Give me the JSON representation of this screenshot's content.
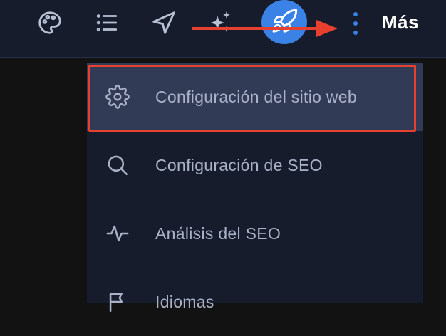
{
  "toolbar": {
    "icons": [
      "palette-icon",
      "list-icon",
      "navigation-icon",
      "sparkles-icon",
      "rocket-icon",
      "more-vertical-icon"
    ],
    "more_label": "Más",
    "accent_color": "#3b82e6"
  },
  "menu": {
    "items": [
      {
        "label": "Configuración del sitio web",
        "icon": "gear-icon",
        "active": true
      },
      {
        "label": "Configuración de SEO",
        "icon": "search-icon",
        "active": false
      },
      {
        "label": "Análisis del SEO",
        "icon": "activity-icon",
        "active": false
      },
      {
        "label": "Idiomas",
        "icon": "flag-icon",
        "active": false
      }
    ]
  },
  "annotation": {
    "color": "#e8402f"
  }
}
